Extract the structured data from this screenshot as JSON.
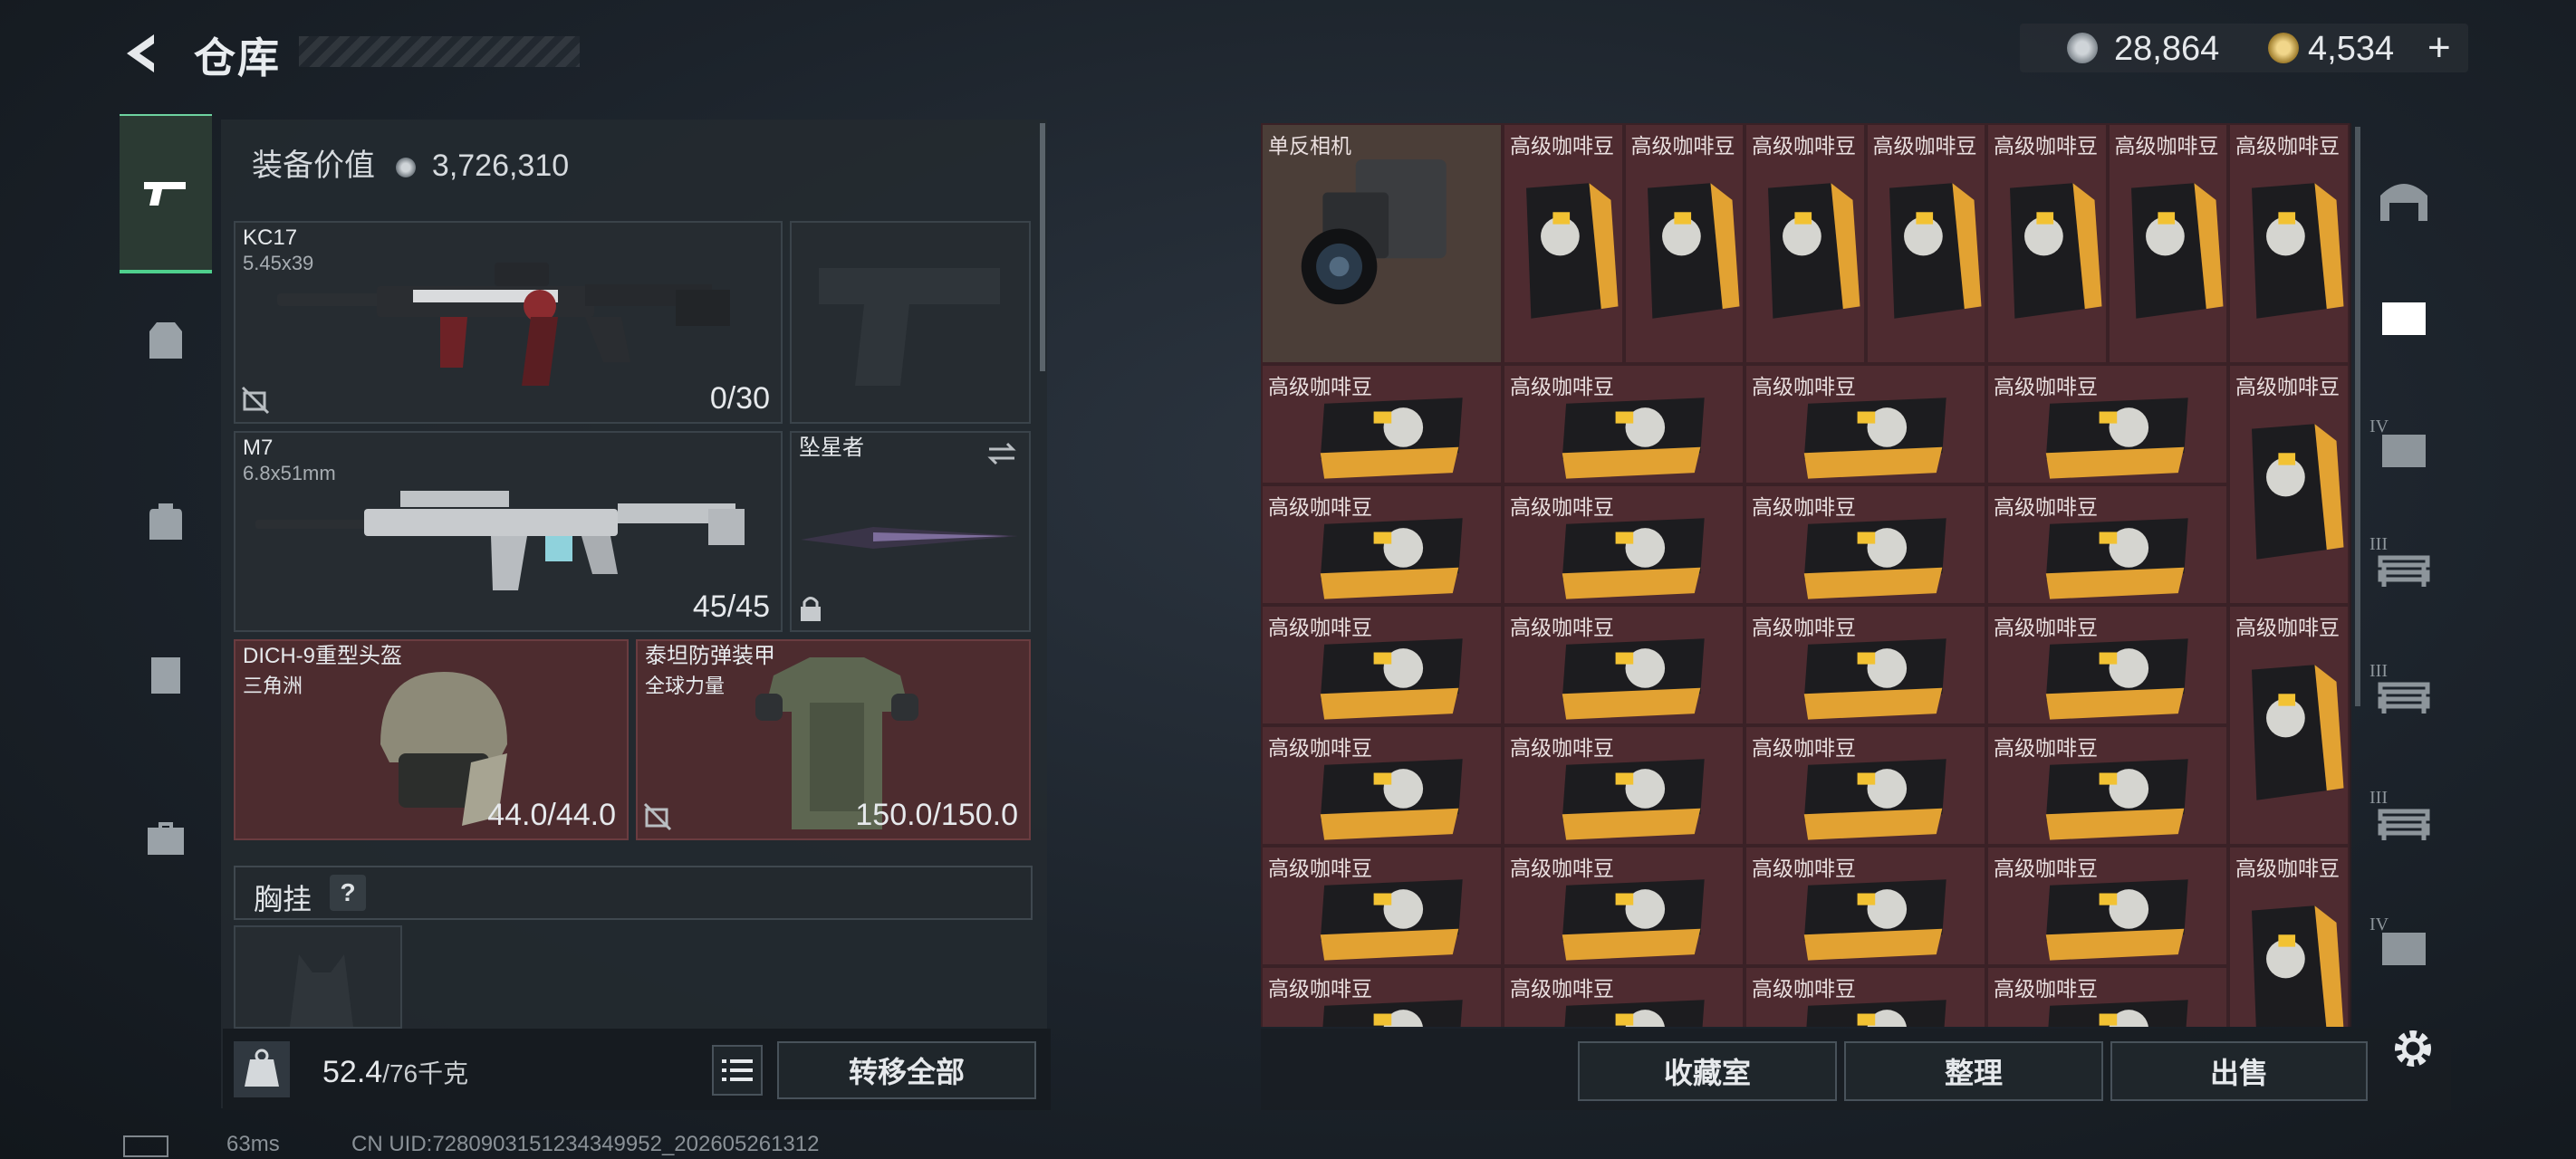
{
  "header": {
    "title": "仓库",
    "currency": [
      {
        "icon": "silver-coin-icon",
        "value": "28,864"
      },
      {
        "icon": "gold-coin-icon",
        "value": "4,534"
      }
    ],
    "add_label": "+"
  },
  "left_nav": {
    "items": [
      {
        "icon": "pistol-icon",
        "active": true
      },
      {
        "icon": "vest-icon",
        "active": false
      },
      {
        "icon": "backpack-icon",
        "active": false
      },
      {
        "icon": "locker-icon",
        "active": false
      },
      {
        "icon": "briefcase-icon",
        "active": false
      }
    ]
  },
  "equipment": {
    "label": "装备价值",
    "value": "3,726,310",
    "slots": {
      "primary": {
        "name": "KC17",
        "caliber": "5.45x39",
        "ammo": "0/30"
      },
      "secondary": {
        "name": "M7",
        "caliber": "6.8x51mm",
        "ammo": "45/45"
      },
      "melee": {
        "name": "坠星者"
      },
      "helmet": {
        "name": "DICH-9重型头盔",
        "origin": "三角洲",
        "durability": "44.0/44.0"
      },
      "armor": {
        "name": "泰坦防弹装甲",
        "origin": "全球力量",
        "durability": "150.0/150.0"
      }
    },
    "chest_rig": {
      "label": "胸挂",
      "help": "?"
    }
  },
  "inventory_bar": {
    "weight": "52.4",
    "weight_max": "/76千克",
    "transfer_label": "转移全部"
  },
  "stash": {
    "camera_label": "单反相机",
    "coffee_label": "高级咖啡豆"
  },
  "stash_actions": {
    "collection_label": "收藏室",
    "sort_label": "整理",
    "sell_label": "出售"
  },
  "right_nav": {
    "items": [
      {
        "icon": "hangar-icon",
        "tier": ""
      },
      {
        "icon": "safe-icon",
        "tier": ""
      },
      {
        "icon": "safe-icon",
        "tier": "IV"
      },
      {
        "icon": "shelf-icon",
        "tier": "III"
      },
      {
        "icon": "shelf-icon",
        "tier": "III"
      },
      {
        "icon": "shelf-icon",
        "tier": "III"
      },
      {
        "icon": "safe-icon",
        "tier": "IV"
      }
    ]
  },
  "status_bar": {
    "ping": "63ms",
    "uid": "CN UID:7280903151234349952_202605261312"
  }
}
